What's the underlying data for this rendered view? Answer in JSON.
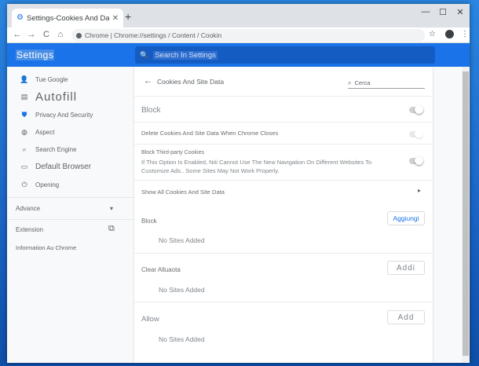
{
  "tab": {
    "title": "Settings-Cookies And Data",
    "icon": "gear-icon",
    "close": "✕",
    "new_tab": "+"
  },
  "window_controls": {
    "minimize": "—",
    "maximize": "☐",
    "close": "✕"
  },
  "toolbar": {
    "back": "←",
    "forward": "→",
    "reload": "C",
    "home": "⌂",
    "address": "Chrome | Chrome://settings / Content / Cookin",
    "star": "☆",
    "menu": "⋮"
  },
  "header": {
    "title": "Settings",
    "search_icon": "search-icon",
    "search_placeholder": "Search In Settings"
  },
  "sidebar": {
    "items": [
      {
        "icon": "👤",
        "label": "Tue Google"
      },
      {
        "icon": "▤",
        "label": "Autofill"
      },
      {
        "icon": "⛊",
        "label": "Privacy And Security"
      },
      {
        "icon": "◍",
        "label": "Aspect"
      },
      {
        "icon": "⌕",
        "label": "Search Engine"
      },
      {
        "icon": "▭",
        "label": "Default Browser"
      },
      {
        "icon": "⏻",
        "label": "Opening"
      }
    ],
    "advanced": "Advance",
    "advanced_chevron": "▾",
    "extension": "Extension",
    "extension_icon": "⧉",
    "about": "Information Au Chrome"
  },
  "content": {
    "back_arrow": "←",
    "title": "Cookies And Site Data",
    "search_icon": "⌕",
    "search_value": "Cerca",
    "block_label": "Block",
    "delete_label": "Delete Cookies And Site Data When Chrome Closes",
    "third_party_title": "Block Third-party Cookies",
    "third_party_desc_line1": "If This Option Is Enabled, Niti Cannot Use The New Navigation On Different Websites To",
    "third_party_desc_line2": "Customize Ads.. Some Sites May Not Work Properly.",
    "show_all": "Show All Cookies And Site Data",
    "show_all_arrow": "▸",
    "sections": [
      {
        "title": "Block",
        "button": "Aggiungi",
        "empty": "No Sites Added"
      },
      {
        "title": "Clear Alluaota",
        "button": "Addi",
        "empty": "No Sites Added"
      },
      {
        "title": "Allow",
        "button": "Add",
        "empty": "No Sites Added"
      }
    ]
  },
  "toggles": {
    "block": "off",
    "delete_on_close": "off",
    "third_party": "off"
  },
  "colors": {
    "accent": "#1a73e8",
    "header_bg": "#1a73e8",
    "desktop": "#1a6fd0"
  }
}
